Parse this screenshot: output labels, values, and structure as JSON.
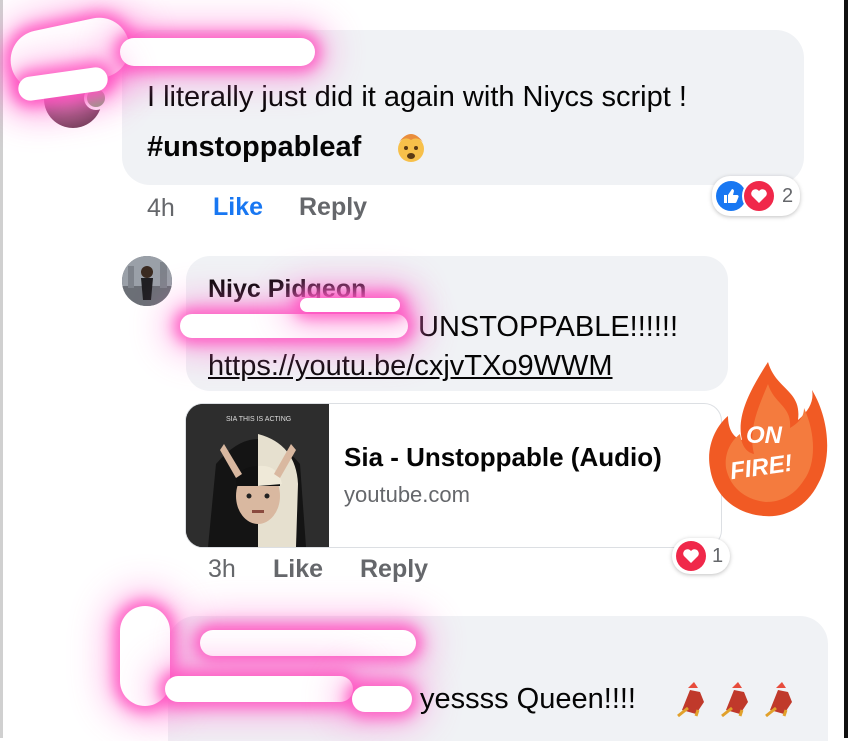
{
  "comments": [
    {
      "text_line1": "I literally just did it again with Niycs script !",
      "text_line2": "#unstoppableaf",
      "emoji": "exploding-head-emoji",
      "time": "4h",
      "like_label": "Like",
      "reply_label": "Reply",
      "reaction_count": "2"
    },
    {
      "author": "Niyc Pidgeon",
      "text_line1": "UNSTOPPABLE!!!!!!",
      "link": "https://youtu.be/cxjvTXo9WWM",
      "card_title": "Sia - Unstoppable (Audio)",
      "card_domain": "youtube.com",
      "thumb_caption": "SIA THIS IS ACTING",
      "time": "3h",
      "like_label": "Like",
      "reply_label": "Reply",
      "reaction_count": "1"
    },
    {
      "text_line1": "yessss Queen!!!!",
      "emoji": "dancing-chicken-emoji"
    }
  ],
  "sticker": {
    "line1": "ON",
    "line2": "FIRE!"
  },
  "colors": {
    "accent_blue": "#1877f2",
    "love_red": "#f0284a",
    "bubble_gray": "#f0f2f5",
    "highlight_pink": "#ff50be"
  }
}
